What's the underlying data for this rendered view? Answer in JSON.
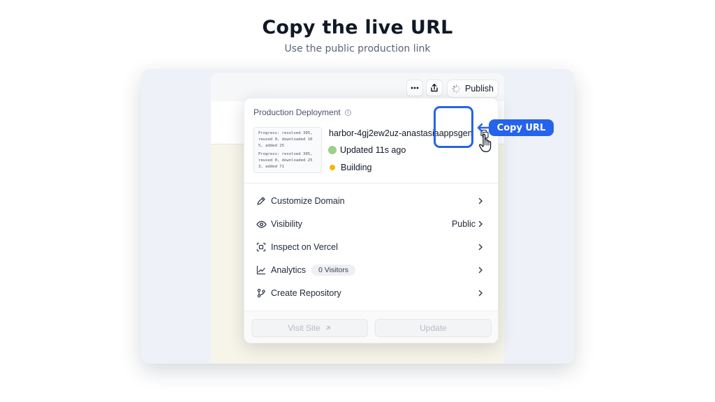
{
  "page": {
    "title": "Copy the live URL",
    "subtitle": "Use the public production link"
  },
  "toolbar": {
    "more_icon": "more-horizontal-icon",
    "share_icon": "share-icon",
    "publish_label": "Publish",
    "publish_icon": "spinner-icon"
  },
  "deployment": {
    "heading": "Production Deployment",
    "info_icon": "info-icon",
    "log_lines": [
      "Progress: resolved 395, reused 0, downloaded 10 5, added 25",
      "Progress: resolved 395, reused 0, downloaded 25 3, added 71"
    ],
    "url": "harbor-4gj2ew2uz-anastasiaappsgen",
    "updated": "Updated 11s ago",
    "status": "Building",
    "status_color": "#f5b70a"
  },
  "menu": {
    "items": [
      {
        "label": "Customize Domain",
        "icon": "pencil-icon"
      },
      {
        "label": "Visibility",
        "icon": "eye-icon",
        "value": "Public"
      },
      {
        "label": "Inspect on Vercel",
        "icon": "inspect-icon"
      },
      {
        "label": "Analytics",
        "icon": "chart-line-icon",
        "badge": "0 Visitors"
      },
      {
        "label": "Create Repository",
        "icon": "git-branch-icon"
      }
    ]
  },
  "footer": {
    "visit_label": "Visit Site",
    "update_label": "Update"
  },
  "callout": {
    "label": "Copy URL",
    "accent": "#2563eb"
  }
}
